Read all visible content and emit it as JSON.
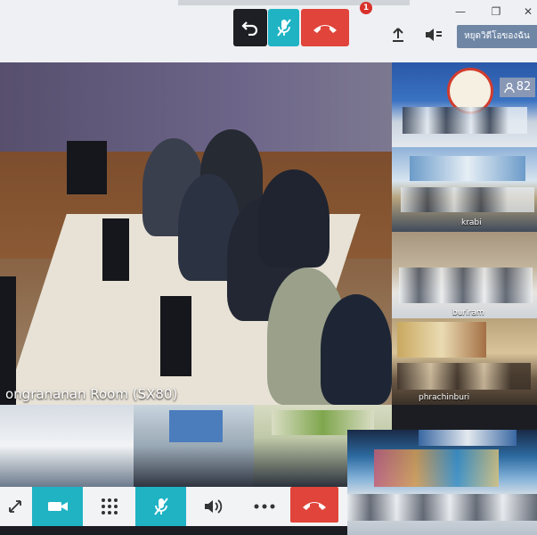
{
  "notification": {
    "count": "1"
  },
  "window": {
    "minimize": "—",
    "restore": "❐",
    "close": "✕"
  },
  "toolbar": {
    "hide_self_label": "หยุดวิดีโอของฉัน"
  },
  "participants": {
    "count": "82"
  },
  "main_video": {
    "room_label": "ongrananan Room (SX80)"
  },
  "tiles": [
    {
      "label": ""
    },
    {
      "label": "krabi"
    },
    {
      "label": "buriram"
    },
    {
      "label": "phrachinburi"
    }
  ],
  "colors": {
    "accent": "#1fb3c4",
    "danger": "#e0443a",
    "dark_button": "#1d1f24"
  }
}
